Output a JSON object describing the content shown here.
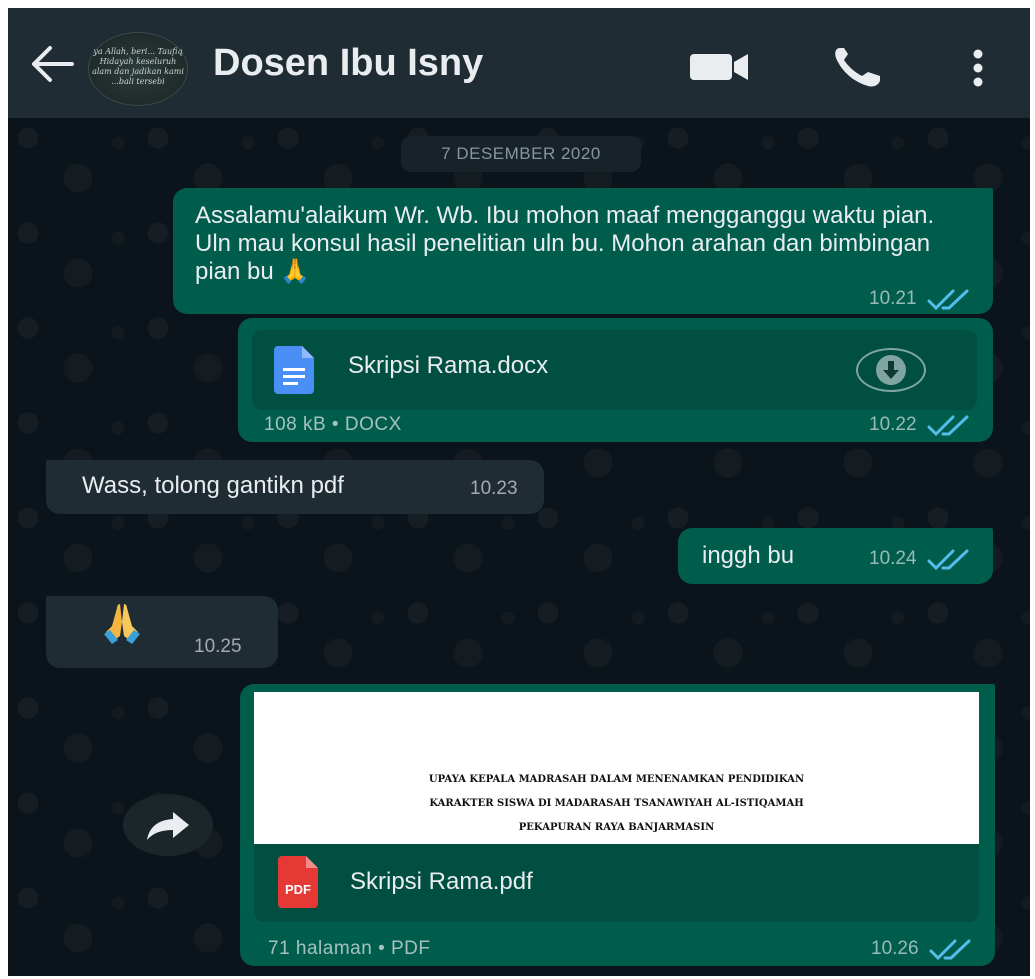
{
  "header": {
    "contact_name": "Dosen Ibu Isny",
    "avatar_text": "ya Allah, beri... Taufiq Hidayah keseluruh alam dan jadikan kami ...bali tersebi"
  },
  "date_chip": "7 DESEMBER 2020",
  "messages": [
    {
      "type": "text",
      "direction": "outgoing",
      "text": "Assalamu'alaikum Wr. Wb. Ibu mohon maaf mengganggu waktu pian. Uln mau konsul hasil penelitian uln bu. Mohon arahan dan bimbingan pian bu 🙏",
      "time": "10.21",
      "read": true
    },
    {
      "type": "document",
      "direction": "outgoing",
      "file_name": "Skripsi Rama.docx",
      "file_info": "108 kB • DOCX",
      "time": "10.22",
      "read": true
    },
    {
      "type": "text",
      "direction": "incoming",
      "text": "Wass, tolong gantikn pdf",
      "time": "10.23"
    },
    {
      "type": "text",
      "direction": "outgoing",
      "text": "inggh bu",
      "time": "10.24",
      "read": true
    },
    {
      "type": "emoji",
      "direction": "incoming",
      "emoji_name": "folded-hands",
      "time": "10.25"
    },
    {
      "type": "pdf",
      "direction": "outgoing",
      "preview_lines": [
        "UPAYA KEPALA MADRASAH DALAM MENENAMKAN PENDIDIKAN",
        "KARAKTER SISWA DI MADARASAH TSANAWIYAH AL-ISTIQAMAH",
        "PEKAPURAN RAYA BANJARMASIN"
      ],
      "file_name": "Skripsi Rama.pdf",
      "file_info": "71 halaman • PDF",
      "time": "10.26",
      "read": true
    }
  ],
  "colors": {
    "header_bg": "#1f2c33",
    "chat_bg": "#0b141a",
    "outgoing_bubble": "#005c4b",
    "incoming_bubble": "#202c33",
    "read_ticks": "#53bdeb",
    "doc_icon": "#4a8ff5",
    "pdf_icon": "#e53935"
  },
  "icons": {
    "back": "arrow-left-icon",
    "video": "video-camera-icon",
    "call": "phone-icon",
    "menu": "vertical-dots-icon",
    "download": "download-icon",
    "forward": "forward-arrow-icon",
    "doc": "document-icon",
    "pdf": "pdf-icon"
  }
}
